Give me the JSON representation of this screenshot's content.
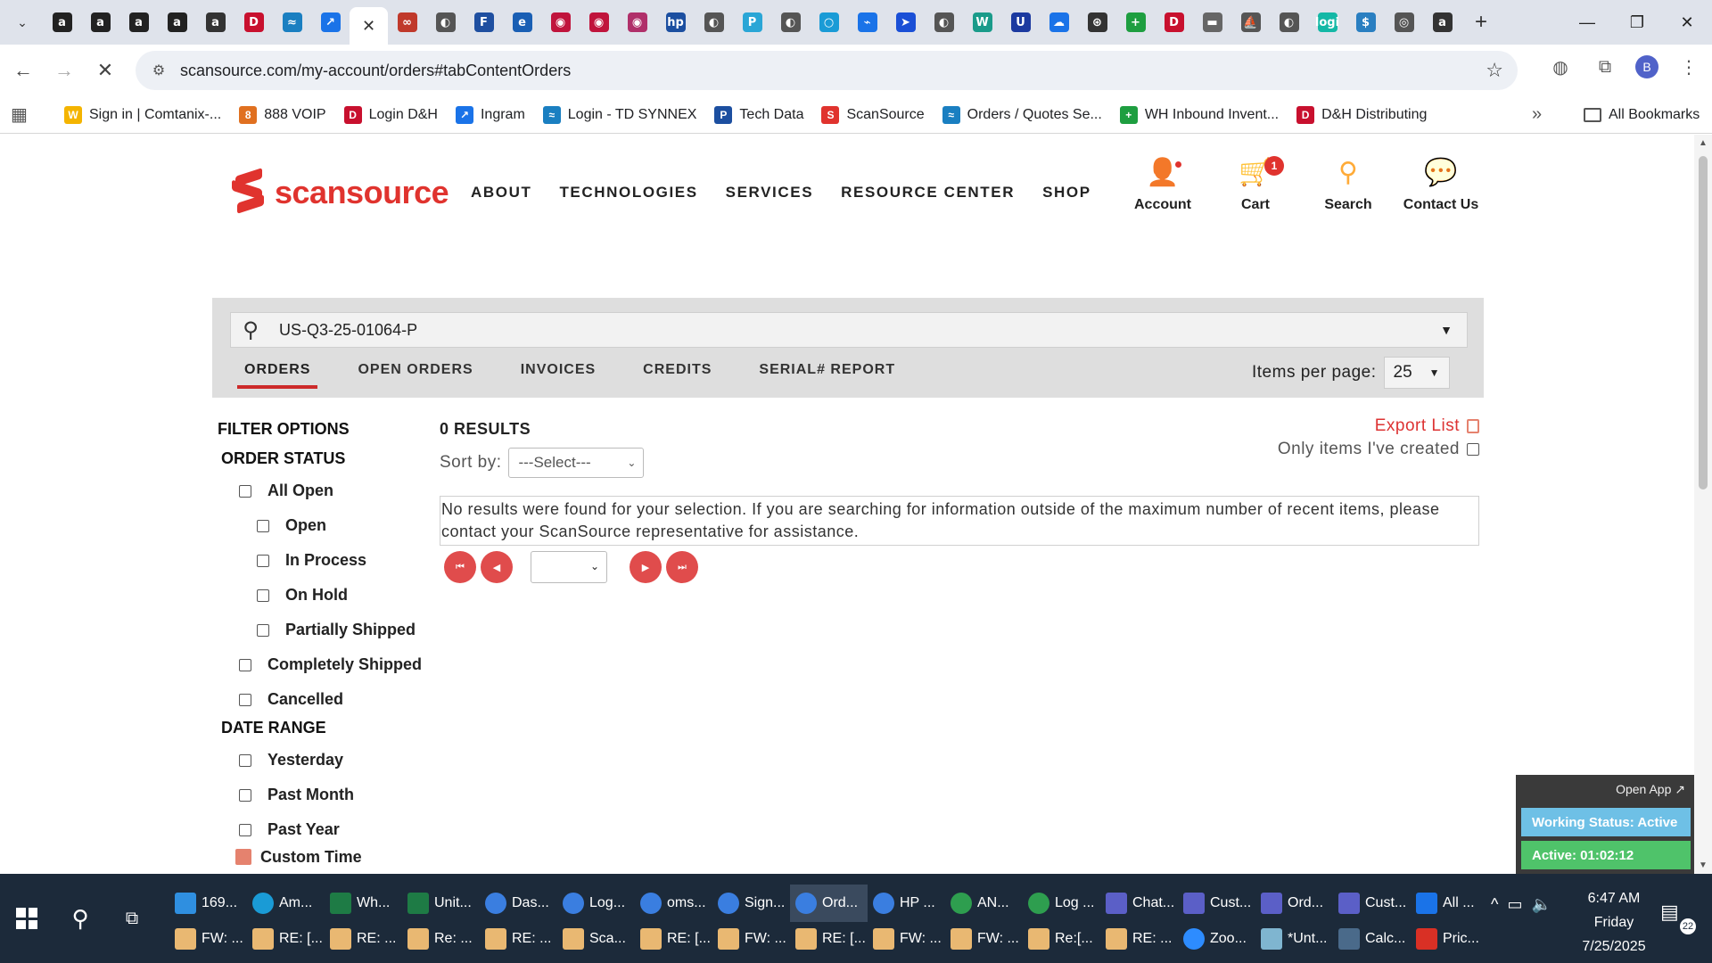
{
  "browser": {
    "tabs": [
      {
        "icon": "amazon-icon",
        "glyph": "a",
        "color": "#222222"
      },
      {
        "icon": "amazon-icon",
        "glyph": "a",
        "color": "#222222"
      },
      {
        "icon": "amazon-icon",
        "glyph": "a",
        "color": "#222222"
      },
      {
        "icon": "amazon-icon",
        "glyph": "a",
        "color": "#222222"
      },
      {
        "icon": "amazon-circle-icon",
        "glyph": "a",
        "color": "#333333"
      },
      {
        "icon": "dh-icon",
        "glyph": "D",
        "color": "#c8102e"
      },
      {
        "icon": "td-synnex-icon",
        "glyph": "≈",
        "color": "#1a7fc1"
      },
      {
        "icon": "ingram-icon",
        "glyph": "↗",
        "color": "#1a73e8"
      },
      {
        "icon": "close-icon",
        "glyph": "✕",
        "color": "#ffffff",
        "active": true
      },
      {
        "icon": "link-icon",
        "glyph": "∞",
        "color": "#c0392b"
      },
      {
        "icon": "globe-icon",
        "glyph": "◐",
        "color": "#555555"
      },
      {
        "icon": "ftn-icon",
        "glyph": "F",
        "color": "#1f4fa0"
      },
      {
        "icon": "edge-e-icon",
        "glyph": "e",
        "color": "#1a5fb4"
      },
      {
        "icon": "lg-icon",
        "glyph": "◉",
        "color": "#c0143c"
      },
      {
        "icon": "lg-icon",
        "glyph": "◉",
        "color": "#c0143c"
      },
      {
        "icon": "pink-circle-icon",
        "glyph": "◉",
        "color": "#b0306a"
      },
      {
        "icon": "hp-icon",
        "glyph": "hp",
        "color": "#1c4fa0"
      },
      {
        "icon": "globe-icon",
        "glyph": "◐",
        "color": "#555555"
      },
      {
        "icon": "p-icon",
        "glyph": "P",
        "color": "#2aa6d6"
      },
      {
        "icon": "globe-icon",
        "glyph": "◐",
        "color": "#555555"
      },
      {
        "icon": "ring-icon",
        "glyph": "○",
        "color": "#1a9bd6"
      },
      {
        "icon": "connect-icon",
        "glyph": "⌁",
        "color": "#1a73e8"
      },
      {
        "icon": "arrow-icon",
        "glyph": "➤",
        "color": "#1a4fd6"
      },
      {
        "icon": "globe-icon",
        "glyph": "◐",
        "color": "#555555"
      },
      {
        "icon": "w-icon",
        "glyph": "W",
        "color": "#1a9b8a"
      },
      {
        "icon": "u-icon",
        "glyph": "U",
        "color": "#1c3aa0"
      },
      {
        "icon": "cloud-icon",
        "glyph": "☁",
        "color": "#1a73e8"
      },
      {
        "icon": "openai-icon",
        "glyph": "⊛",
        "color": "#333333"
      },
      {
        "icon": "plus-green-icon",
        "glyph": "+",
        "color": "#1e9e40"
      },
      {
        "icon": "dh-icon",
        "glyph": "D",
        "color": "#c8102e"
      },
      {
        "icon": "white-icon",
        "glyph": "▬",
        "color": "#666666"
      },
      {
        "icon": "boat-icon",
        "glyph": "⛵",
        "color": "#555555"
      },
      {
        "icon": "globe-icon",
        "glyph": "◐",
        "color": "#555555"
      },
      {
        "icon": "logi-icon",
        "glyph": "logi",
        "color": "#14b8a6"
      },
      {
        "icon": "s-dollar-icon",
        "glyph": "$",
        "color": "#2a7fc1"
      },
      {
        "icon": "target-icon",
        "glyph": "◎",
        "color": "#555555"
      },
      {
        "icon": "amazon-icon",
        "glyph": "a",
        "color": "#333333"
      }
    ],
    "url": "scansource.com/my-account/orders#tabContentOrders",
    "profile_initial": "B",
    "bookmarks": [
      {
        "label": "Sign in | Comtanix-...",
        "color": "#f4b400",
        "glyph": "W"
      },
      {
        "label": "888 VOIP",
        "color": "#e07020",
        "glyph": "8"
      },
      {
        "label": "Login D&H",
        "color": "#c8102e",
        "glyph": "D"
      },
      {
        "label": "Ingram",
        "color": "#1a73e8",
        "glyph": "↗"
      },
      {
        "label": "Login - TD SYNNEX",
        "color": "#1a7fc1",
        "glyph": "≈"
      },
      {
        "label": "Tech Data",
        "color": "#1c4fa0",
        "glyph": "P"
      },
      {
        "label": "ScanSource",
        "color": "#e0332e",
        "glyph": "S"
      },
      {
        "label": "Orders / Quotes Se...",
        "color": "#1a7fc1",
        "glyph": "≈"
      },
      {
        "label": "WH Inbound Invent...",
        "color": "#1e9e40",
        "glyph": "+"
      },
      {
        "label": "D&H Distributing",
        "color": "#c8102e",
        "glyph": "D"
      }
    ],
    "all_bookmarks": "All Bookmarks"
  },
  "site": {
    "logo_text": "scansource",
    "nav": [
      "ABOUT",
      "TECHNOLOGIES",
      "SERVICES",
      "RESOURCE CENTER",
      "SHOP"
    ],
    "top_icons": [
      {
        "label": "Account",
        "icon": "account-icon"
      },
      {
        "label": "Cart",
        "icon": "cart-icon",
        "badge": "1"
      },
      {
        "label": "Search",
        "icon": "search-icon"
      },
      {
        "label": "Contact Us",
        "icon": "chat-icon"
      }
    ]
  },
  "orders": {
    "search_value": "US-Q3-25-01064-P",
    "subtabs": [
      "ORDERS",
      "OPEN ORDERS",
      "INVOICES",
      "CREDITS",
      "SERIAL# REPORT"
    ],
    "active_subtab": "ORDERS",
    "items_per_page_label": "Items per page:",
    "items_per_page_value": "25",
    "filter_title": "FILTER OPTIONS",
    "order_status_title": "ORDER STATUS",
    "order_status": [
      {
        "label": "All Open",
        "level": 1
      },
      {
        "label": "Open",
        "level": 2
      },
      {
        "label": "In Process",
        "level": 2
      },
      {
        "label": "On Hold",
        "level": 2
      },
      {
        "label": "Partially Shipped",
        "level": 2
      },
      {
        "label": "Completely Shipped",
        "level": 1
      },
      {
        "label": "Cancelled",
        "level": 1
      }
    ],
    "date_range_title": "DATE RANGE",
    "date_range": [
      "Yesterday",
      "Past Month",
      "Past Year"
    ],
    "custom_time": "Custom Time",
    "results_count": "0 RESULTS",
    "sort_label": "Sort by:",
    "sort_value": "---Select---",
    "export_label": "Export List",
    "only_mine_label": "Only items I've created",
    "no_results_message": "No results were found for your selection. If you are searching for information outside of the maximum number of recent items, please contact your ScanSource representative for assistance."
  },
  "status_widget": {
    "open_app": "Open App ↗",
    "working_status": "Working Status: Active",
    "active_time": "Active: 01:02:12"
  },
  "taskbar": {
    "row1": [
      {
        "label": "169...",
        "color": "#2f8fe0",
        "sq": true
      },
      {
        "label": "Am...",
        "color": "#1a9bd6",
        "sq": false
      },
      {
        "label": "Wh...",
        "color": "#1e7b45",
        "sq": true
      },
      {
        "label": "Unit...",
        "color": "#1e7b45",
        "sq": true
      },
      {
        "label": "Das...",
        "color": "#3a7ee0",
        "sq": false
      },
      {
        "label": "Log...",
        "color": "#3a7ee0",
        "sq": false
      },
      {
        "label": "oms...",
        "color": "#3a7ee0",
        "sq": false
      },
      {
        "label": "Sign...",
        "color": "#3a7ee0",
        "sq": false
      },
      {
        "label": "Ord...",
        "color": "#3a7ee0",
        "sq": false,
        "active": true
      },
      {
        "label": "HP ...",
        "color": "#3a7ee0",
        "sq": false
      },
      {
        "label": "AN...",
        "color": "#2e9e4f",
        "sq": false
      },
      {
        "label": "Log ...",
        "color": "#2e9e4f",
        "sq": false
      },
      {
        "label": "Chat...",
        "color": "#5b5fc7",
        "sq": true
      },
      {
        "label": "Cust...",
        "color": "#5b5fc7",
        "sq": true
      },
      {
        "label": "Ord...",
        "color": "#5b5fc7",
        "sq": true
      },
      {
        "label": "Cust...",
        "color": "#5b5fc7",
        "sq": true
      },
      {
        "label": "All ...",
        "color": "#1a73e8",
        "sq": true
      }
    ],
    "row2": [
      {
        "label": "FW: ...",
        "color": "#e9b872",
        "sq": true
      },
      {
        "label": "RE: [...",
        "color": "#e9b872",
        "sq": true
      },
      {
        "label": "RE: ...",
        "color": "#e9b872",
        "sq": true
      },
      {
        "label": "Re: ...",
        "color": "#e9b872",
        "sq": true
      },
      {
        "label": "RE: ...",
        "color": "#e9b872",
        "sq": true
      },
      {
        "label": "Sca...",
        "color": "#e9b872",
        "sq": true
      },
      {
        "label": "RE: [...",
        "color": "#e9b872",
        "sq": true
      },
      {
        "label": "FW: ...",
        "color": "#e9b872",
        "sq": true
      },
      {
        "label": "RE: [...",
        "color": "#e9b872",
        "sq": true
      },
      {
        "label": "FW: ...",
        "color": "#e9b872",
        "sq": true
      },
      {
        "label": "FW: ...",
        "color": "#e9b872",
        "sq": true
      },
      {
        "label": "Re:[...",
        "color": "#e9b872",
        "sq": true
      },
      {
        "label": "RE: ...",
        "color": "#e9b872",
        "sq": true
      },
      {
        "label": "Zoo...",
        "color": "#2d8cff",
        "sq": false
      },
      {
        "label": "*Unt...",
        "color": "#7fb5d0",
        "sq": true
      },
      {
        "label": "Calc...",
        "color": "#4a6a8a",
        "sq": true
      },
      {
        "label": "Pric...",
        "color": "#d93025",
        "sq": true
      }
    ],
    "clock_time": "6:47 AM",
    "clock_day": "Friday",
    "clock_date": "7/25/2025",
    "notifications": "22"
  }
}
